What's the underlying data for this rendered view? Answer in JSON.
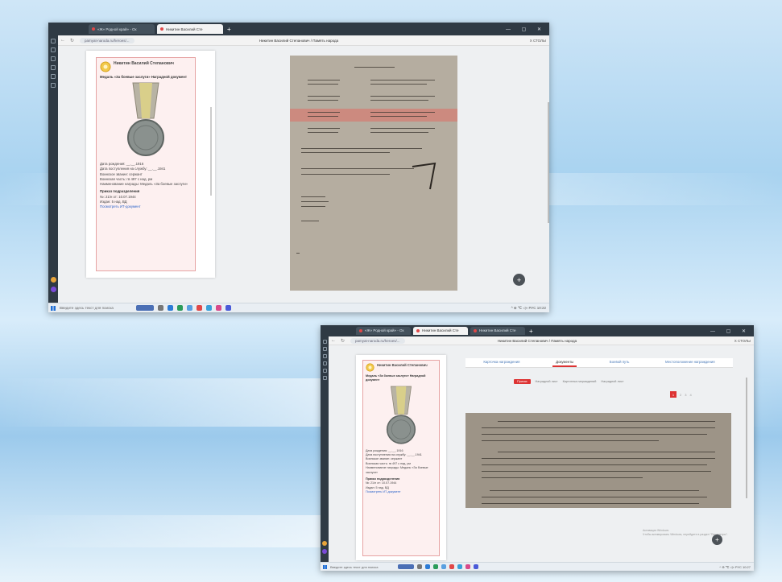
{
  "screenshot1": {
    "tabs": [
      {
        "label": "«Ж» Родной край» - Ох",
        "active": false
      },
      {
        "label": "Никитин Василий Сте",
        "active": true
      }
    ],
    "url": "pamyat-naroda.ru/heroes/...",
    "page_title": "Никитин Василий Степанович / Память народа",
    "zoom": "Х СТОЛЫ",
    "award": {
      "name": "Никитин Василий Степанович",
      "title": "Медаль «За боевые заслуги» Наградной документ",
      "details": [
        "Дата рождения: __.__.1916",
        "Дата поступления на службу: __.__.1941",
        "Воинское звание: сержант",
        "Воинская часть: гв 497 с над. рм",
        "Наименование награды: Медаль «За боевые заслуги»"
      ],
      "section": "Приказ подразделения",
      "order_rows": [
        "№: 21/н от: 10.07.1944",
        "Издан: 5 над. ВД"
      ],
      "link": "Посмотреть ИТ-документ"
    },
    "taskbar_search": "Введите здесь текст для поиска",
    "tray": "^ ⊕ ℃ ◁» РУС 10:22"
  },
  "screenshot2": {
    "tabs": [
      {
        "label": "«Ж» Родной край» - Ох",
        "active": false
      },
      {
        "label": "Никитин Василий Сте",
        "active": true
      },
      {
        "label": "Никитин Василий Сте",
        "active": false
      }
    ],
    "url": "pamyat-naroda.ru/heroes/...",
    "page_title": "Никитин Василий Степанович / Память народа",
    "zoom": "Х СТОЛЫ",
    "nav_tabs": [
      {
        "label": "Карточка награждения",
        "active": false
      },
      {
        "label": "Документы",
        "active": true
      },
      {
        "label": "Боевой путь",
        "active": false
      },
      {
        "label": "Местоположение награждения",
        "active": false
      }
    ],
    "chips": [
      "Приказ",
      "Наградной лист",
      "Картотека награждений",
      "Наградной лист"
    ],
    "pager": [
      "1",
      "2",
      "3",
      "4"
    ],
    "award": {
      "name": "Никитин Василий Степанович",
      "title": "Медаль «За боевые заслуги» Наградной документ",
      "details": [
        "Дата рождения: __.__.1916",
        "Дата поступления на службу: __.__.1941",
        "Воинское звание: сержант",
        "Воинская часть: гв 497 с над. рм",
        "Наименование награды: Медаль «За боевые заслуги»"
      ],
      "section": "Приказ подразделения",
      "order_rows": [
        "№: 21/н от: 10.07.1944",
        "Издан: 5 над. ВД"
      ],
      "link": "Посмотреть ИТ-документ"
    },
    "watermark": [
      "Активация Windows",
      "Чтобы активировать Windows, перейдите в раздел \"Параметры\"."
    ],
    "taskbar_search": "Введите здесь текст для поиска",
    "tray": "^ ⊕ ℃ ◁» РУС 10:27"
  },
  "colors": {
    "accent": "#dd3333",
    "award_border": "#e6a3a3",
    "chrome": "#2f3a44"
  },
  "icons": [
    "close-icon",
    "back-icon",
    "search-icon",
    "add-tab-icon",
    "medal-icon",
    "windows-icon",
    "plus-icon"
  ]
}
